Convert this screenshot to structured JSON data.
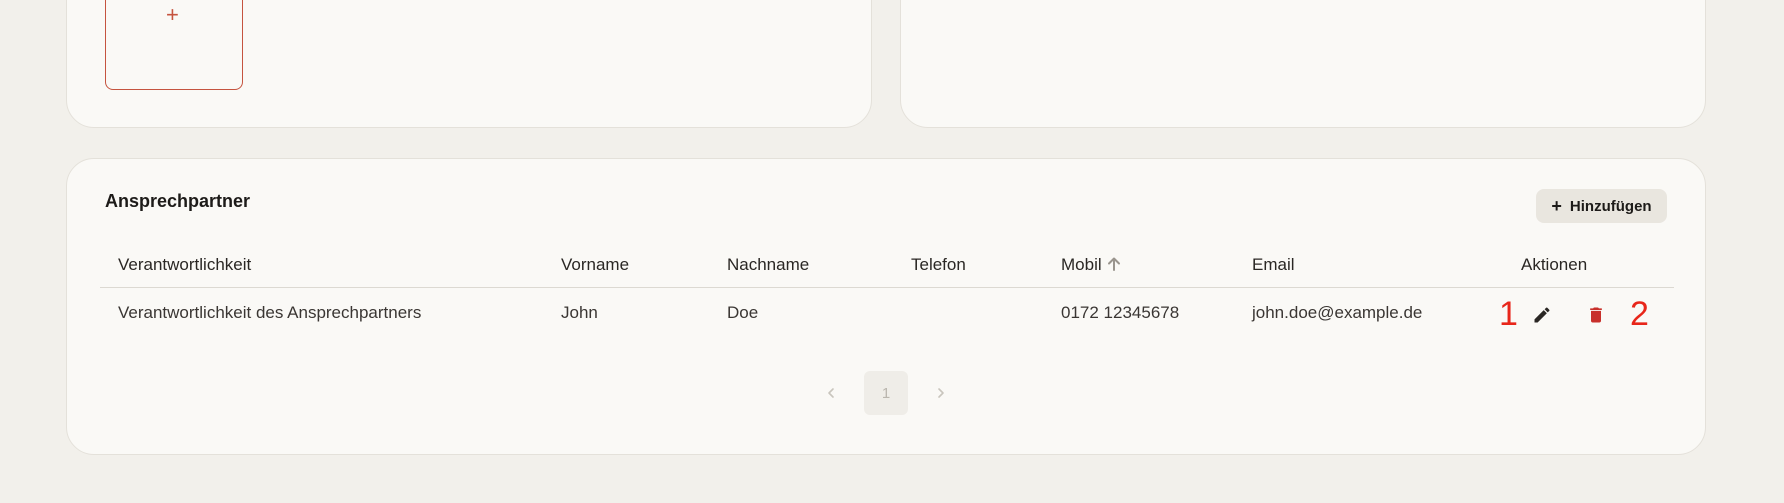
{
  "upload": {
    "plus_icon": "plus-icon",
    "plus_symbol": "+"
  },
  "contacts": {
    "title": "Ansprechpartner",
    "add_button_label": "Hinzufügen",
    "add_button_icon": "plus-icon",
    "columns": [
      "Verantwortlichkeit",
      "Vorname",
      "Nachname",
      "Telefon",
      "Mobil",
      "Email",
      "Aktionen"
    ],
    "sort_column": "Mobil",
    "sort_direction": "ascending",
    "rows": [
      {
        "verantwortlichkeit": "Verantwortlichkeit des Ansprechpartners",
        "vorname": "John",
        "nachname": "Doe",
        "telefon": "",
        "mobil": "0172 12345678",
        "email": "john.doe@example.de"
      }
    ],
    "action_markers": [
      "1",
      "2"
    ],
    "action_icons": [
      "edit-icon",
      "delete-icon"
    ]
  },
  "pagination": {
    "current_page": "1"
  },
  "colors": {
    "background": "#f2f0eb",
    "card": "#faf9f6",
    "accent": "#c5543f",
    "delete": "#c8302b",
    "marker": "#e8261a"
  }
}
